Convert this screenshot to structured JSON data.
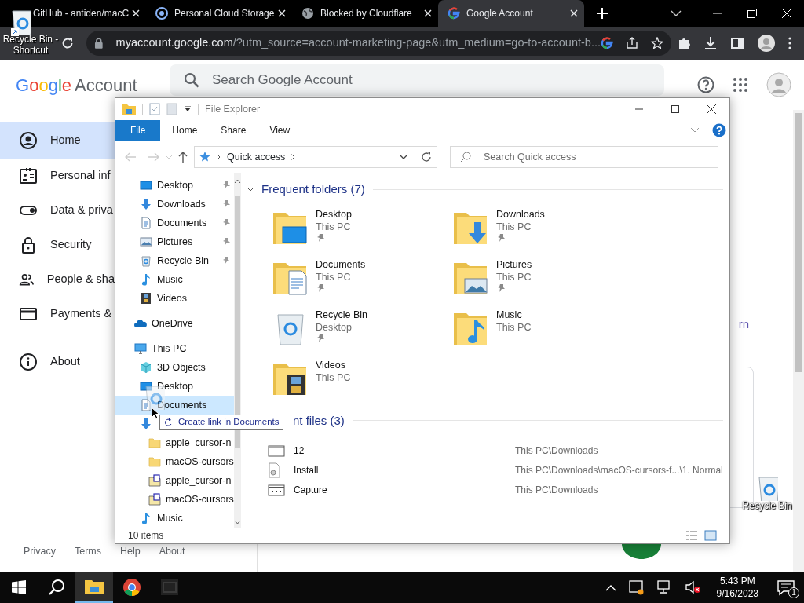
{
  "browser": {
    "tabs": [
      {
        "title": "GitHub - antiden/macC",
        "kind": "github",
        "selected": false
      },
      {
        "title": "Personal Cloud Storage",
        "kind": "cloud",
        "selected": false
      },
      {
        "title": "Blocked by Cloudflare",
        "kind": "globe",
        "selected": false
      },
      {
        "title": "Google Account",
        "kind": "google",
        "selected": true
      }
    ],
    "url_host": "myaccount.google.com",
    "url_rest": "/?utm_source=account-marketing-page&utm_medium=go-to-account-b..."
  },
  "google_page": {
    "logo": "Google",
    "product": "Account",
    "search_placeholder": "Search Google Account",
    "nav": [
      {
        "label": "Home",
        "kind": "home",
        "selected": true
      },
      {
        "label": "Personal inf",
        "kind": "personal",
        "selected": false
      },
      {
        "label": "Data & priva",
        "kind": "data",
        "selected": false
      },
      {
        "label": "Security",
        "kind": "security",
        "selected": false
      },
      {
        "label": "People & sha",
        "kind": "people",
        "selected": false
      },
      {
        "label": "Payments &",
        "kind": "payments",
        "selected": false
      },
      {
        "label": "About",
        "kind": "about",
        "selected": false
      }
    ],
    "partial_link": "rn",
    "footer_links": [
      "Privacy",
      "Terms",
      "Help",
      "About"
    ]
  },
  "explorer": {
    "title": "File Explorer",
    "ribbon_tabs": [
      {
        "label": "File",
        "selected": true
      },
      {
        "label": "Home",
        "selected": false
      },
      {
        "label": "Share",
        "selected": false
      },
      {
        "label": "View",
        "selected": false
      }
    ],
    "address": "Quick access",
    "search_placeholder": "Search Quick access",
    "nav_quick_access": [
      {
        "label": "Desktop",
        "kind": "desktop",
        "pinned": true,
        "selected": false
      },
      {
        "label": "Downloads",
        "kind": "downloads",
        "pinned": true,
        "selected": false
      },
      {
        "label": "Documents",
        "kind": "documents",
        "pinned": true,
        "selected": false
      },
      {
        "label": "Pictures",
        "kind": "pictures",
        "pinned": true,
        "selected": false
      },
      {
        "label": "Recycle Bin",
        "kind": "recycle",
        "pinned": true,
        "selected": false
      },
      {
        "label": "Music",
        "kind": "music",
        "pinned": false,
        "selected": false
      },
      {
        "label": "Videos",
        "kind": "videos",
        "pinned": false,
        "selected": false
      }
    ],
    "nav_tree": [
      {
        "label": "OneDrive",
        "kind": "onedrive",
        "pinned": false,
        "selected": false
      },
      {
        "label": "This PC",
        "kind": "pc",
        "pinned": false,
        "selected": false,
        "children": [
          {
            "label": "3D Objects",
            "kind": "objects3d",
            "pinned": false,
            "selected": false
          },
          {
            "label": "Desktop",
            "kind": "desktop",
            "pinned": false,
            "selected": false
          },
          {
            "label": "Documents",
            "kind": "documents",
            "pinned": false,
            "selected": true
          },
          {
            "kind": "downloads",
            "pinned": false,
            "selected": false,
            "children": [
              {
                "label": "apple_cursor-n",
                "kind": "folder",
                "pinned": false,
                "selected": false
              },
              {
                "label": "macOS-cursors",
                "kind": "folder",
                "pinned": false,
                "selected": false
              },
              {
                "label": "apple_cursor-n",
                "kind": "zip",
                "pinned": false,
                "selected": false
              },
              {
                "label": "macOS-cursors",
                "kind": "zip",
                "pinned": false,
                "selected": false
              }
            ]
          },
          {
            "label": "Music",
            "kind": "music",
            "pinned": false,
            "selected": false
          }
        ]
      }
    ],
    "frequent_heading": "Frequent folders (7)",
    "frequent_folders": [
      {
        "name": "Desktop",
        "location": "This PC",
        "kind": "desktop",
        "pinned": true
      },
      {
        "name": "Downloads",
        "location": "This PC",
        "kind": "downloads",
        "pinned": true
      },
      {
        "name": "Documents",
        "location": "This PC",
        "kind": "documents",
        "pinned": true
      },
      {
        "name": "Pictures",
        "location": "This PC",
        "kind": "pictures",
        "pinned": true
      },
      {
        "name": "Recycle Bin",
        "location": "Desktop",
        "kind": "recycle",
        "pinned": true
      },
      {
        "name": "Music",
        "location": "This PC",
        "kind": "music",
        "pinned": false
      },
      {
        "name": "Videos",
        "location": "This PC",
        "kind": "videos",
        "pinned": false
      }
    ],
    "recent_heading": "nt files (3)",
    "recent_files": [
      {
        "name": "12",
        "path": "This PC\\Downloads",
        "kind": "image"
      },
      {
        "name": "Install",
        "path": "This PC\\Downloads\\macOS-cursors-f...\\1. Normal",
        "kind": "setup"
      },
      {
        "name": "Capture",
        "path": "This PC\\Downloads",
        "kind": "window"
      }
    ],
    "status": "10 items"
  },
  "tooltip": "Create link in Documents",
  "desktop_icons": [
    {
      "label": "Recycle Bin - Shortcut",
      "shortcut": true
    },
    {
      "label": "Recycle Bin",
      "shortcut": false
    }
  ],
  "taskbar": {
    "apps": [
      {
        "kind": "explorer",
        "active": true
      },
      {
        "kind": "chrome",
        "active": false
      },
      {
        "kind": "archiver",
        "active": false
      }
    ],
    "time": "5:43 PM",
    "date": "9/16/2023",
    "notification_count": "1"
  }
}
